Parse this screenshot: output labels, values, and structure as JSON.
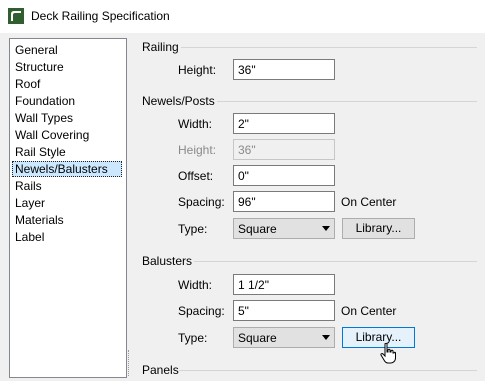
{
  "window": {
    "title": "Deck Railing Specification",
    "icon": "app-logo-icon"
  },
  "nav": {
    "items": [
      {
        "label": "General"
      },
      {
        "label": "Structure"
      },
      {
        "label": "Roof"
      },
      {
        "label": "Foundation"
      },
      {
        "label": "Wall Types"
      },
      {
        "label": "Wall Covering"
      },
      {
        "label": "Rail Style"
      },
      {
        "label": "Newels/Balusters",
        "selected": true
      },
      {
        "label": "Rails"
      },
      {
        "label": "Layer"
      },
      {
        "label": "Materials"
      },
      {
        "label": "Label"
      }
    ]
  },
  "railing": {
    "title": "Railing",
    "height_label": "Height:",
    "height_value": "36\""
  },
  "newels": {
    "title": "Newels/Posts",
    "width_label": "Width:",
    "width_value": "2\"",
    "height_label": "Height:",
    "height_value": "36\"",
    "offset_label": "Offset:",
    "offset_value": "0\"",
    "spacing_label": "Spacing:",
    "spacing_value": "96\"",
    "spacing_unit": "On Center",
    "type_label": "Type:",
    "type_value": "Square",
    "library_label": "Library..."
  },
  "balusters": {
    "title": "Balusters",
    "width_label": "Width:",
    "width_value": "1 1/2\"",
    "spacing_label": "Spacing:",
    "spacing_value": "5\"",
    "spacing_unit": "On Center",
    "type_label": "Type:",
    "type_value": "Square",
    "library_label": "Library..."
  },
  "panels": {
    "title": "Panels"
  },
  "colors": {
    "selection": "#cce8ff",
    "hover_border": "#0078d7"
  }
}
